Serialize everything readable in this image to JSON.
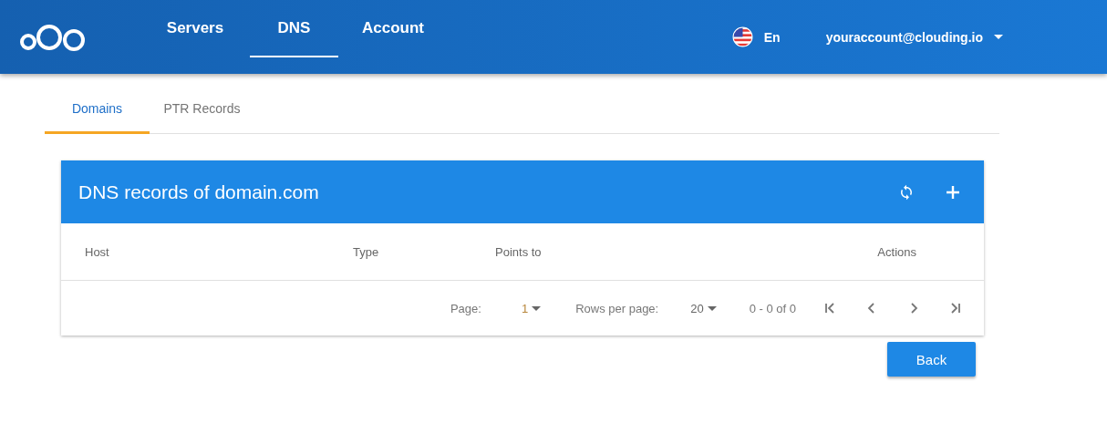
{
  "header": {
    "nav": [
      {
        "label": "Servers",
        "selected": false
      },
      {
        "label": "DNS",
        "selected": true
      },
      {
        "label": "Account",
        "selected": false
      }
    ],
    "language": "En",
    "account": "youraccount@clouding.io"
  },
  "tabs": [
    {
      "label": "Domains",
      "selected": true
    },
    {
      "label": "PTR Records",
      "selected": false
    }
  ],
  "card": {
    "title": "DNS records of domain.com",
    "columns": [
      "Host",
      "Type",
      "Points to",
      "Actions"
    ],
    "pagination": {
      "page_label": "Page:",
      "page": "1",
      "rows_label": "Rows per page:",
      "rows": "20",
      "range": "0 - 0 of 0"
    }
  },
  "back_button": "Back"
}
